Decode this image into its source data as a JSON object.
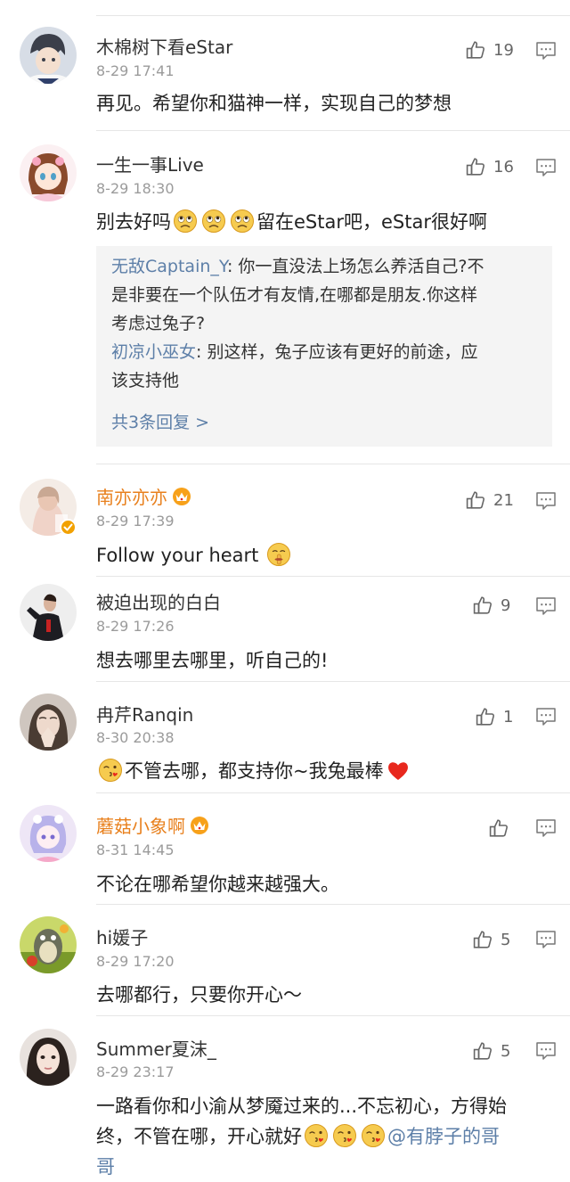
{
  "comments": [
    {
      "name": "木棉树下看eStar",
      "time": "8-29 17:41",
      "likes": "19",
      "text": "再见。希望你和猫神一样，实现自己的梦想"
    },
    {
      "name": "一生一事Live",
      "time": "8-29 18:30",
      "likes": "16",
      "text_a": "别去好吗",
      "text_b": "留在eStar吧，eStar很好啊",
      "replies": [
        {
          "user": "无敌Captain_Y",
          "sep": ": ",
          "l1": "你一直没法上场怎么养活自己?不",
          "l2": "是非要在一个队伍才有友情,在哪都是朋友.你这样",
          "l3": "考虑过兔子?"
        },
        {
          "user": "初凉小巫女",
          "sep": ": ",
          "l1": "别这样，兔子应该有更好的前途，应",
          "l2": "该支持他"
        }
      ],
      "more": "共3条回复 >"
    },
    {
      "name": "南亦亦亦",
      "time": "8-29 17:39",
      "likes": "21",
      "text": "Follow your heart"
    },
    {
      "name": "被迫出现的白白",
      "time": "8-29 17:26",
      "likes": "9",
      "text": "想去哪里去哪里，听自己的!"
    },
    {
      "name": "冉芹Ranqin",
      "time": "8-30 20:38",
      "likes": "1",
      "text": "不管去哪，都支持你~我兔最棒"
    },
    {
      "name": "蘑菇小象啊",
      "time": "8-31 14:45",
      "likes": "",
      "text": "不论在哪希望你越来越强大。"
    },
    {
      "name": "hi媛子",
      "time": "8-29 17:20",
      "likes": "5",
      "text": "去哪都行，只要你开心～"
    },
    {
      "name": "Summer夏沫_",
      "time": "8-29 23:17",
      "likes": "5",
      "l1": "一路看你和小渝从梦魇过来的...不忘初心，方得始",
      "l2": "终，不管在哪，开心就好",
      "mention": "@有脖子的哥",
      "l3": "哥"
    }
  ],
  "colors": {
    "name": "#333333",
    "gold_name": "#e8801d",
    "time": "#9b9b9b",
    "link": "#5d7fa8",
    "reply_bg": "#f4f4f4",
    "badge": "#f2a100",
    "heart": "#e8281e"
  },
  "icons": {
    "like": "thumbs-up-icon",
    "reply": "comment-icon",
    "badge": "verified-badge-icon",
    "crown": "vip-crown-icon",
    "emoji_sad": "sad-face-emoji",
    "emoji_shush": "shushing-face-emoji",
    "emoji_kiss": "blowing-kiss-emoji",
    "emoji_heart": "red-heart-emoji"
  }
}
